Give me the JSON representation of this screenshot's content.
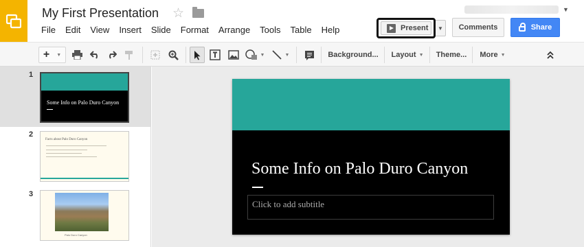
{
  "doc": {
    "title": "My First Presentation"
  },
  "menu": [
    "File",
    "Edit",
    "View",
    "Insert",
    "Slide",
    "Format",
    "Arrange",
    "Tools",
    "Table",
    "Help"
  ],
  "header": {
    "present_label": "Present",
    "comments_label": "Comments",
    "share_label": "Share"
  },
  "toolbar": {
    "new_label": "+",
    "background_label": "Background...",
    "layout_label": "Layout",
    "theme_label": "Theme...",
    "more_label": "More"
  },
  "slides": [
    {
      "number": "1",
      "title": "Some Info on Palo Duro Canyon"
    },
    {
      "number": "2",
      "title": "Facts about Palo Duro Canyon"
    },
    {
      "number": "3",
      "caption": "Palo Duro Canyon"
    }
  ],
  "current_slide": {
    "title": "Some Info on Palo Duro Canyon",
    "subtitle_placeholder": "Click to add subtitle"
  },
  "colors": {
    "accent": "#26a69a",
    "logo": "#f4b400",
    "share": "#4387f5"
  }
}
